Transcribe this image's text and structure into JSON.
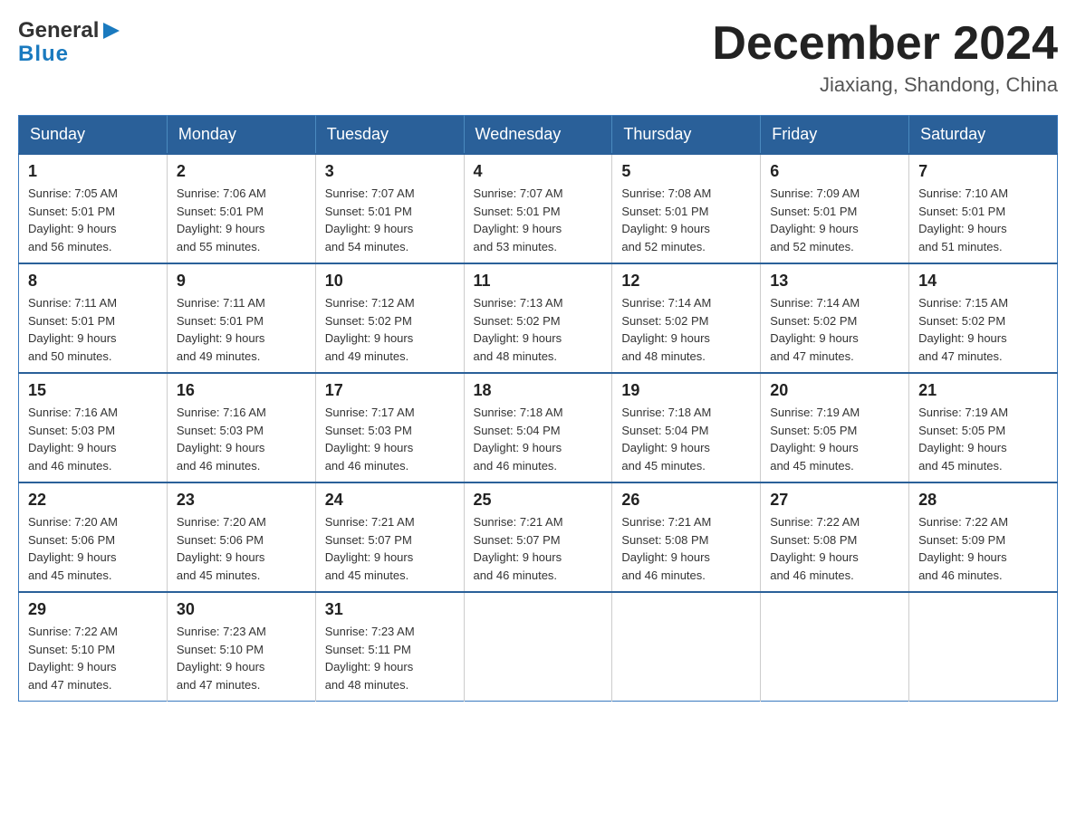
{
  "header": {
    "logo": {
      "general": "General",
      "blue": "Blue"
    },
    "title": "December 2024",
    "location": "Jiaxiang, Shandong, China"
  },
  "days_of_week": [
    "Sunday",
    "Monday",
    "Tuesday",
    "Wednesday",
    "Thursday",
    "Friday",
    "Saturday"
  ],
  "weeks": [
    {
      "days": [
        {
          "number": "1",
          "sunrise": "Sunrise: 7:05 AM",
          "sunset": "Sunset: 5:01 PM",
          "daylight": "Daylight: 9 hours",
          "daylight2": "and 56 minutes."
        },
        {
          "number": "2",
          "sunrise": "Sunrise: 7:06 AM",
          "sunset": "Sunset: 5:01 PM",
          "daylight": "Daylight: 9 hours",
          "daylight2": "and 55 minutes."
        },
        {
          "number": "3",
          "sunrise": "Sunrise: 7:07 AM",
          "sunset": "Sunset: 5:01 PM",
          "daylight": "Daylight: 9 hours",
          "daylight2": "and 54 minutes."
        },
        {
          "number": "4",
          "sunrise": "Sunrise: 7:07 AM",
          "sunset": "Sunset: 5:01 PM",
          "daylight": "Daylight: 9 hours",
          "daylight2": "and 53 minutes."
        },
        {
          "number": "5",
          "sunrise": "Sunrise: 7:08 AM",
          "sunset": "Sunset: 5:01 PM",
          "daylight": "Daylight: 9 hours",
          "daylight2": "and 52 minutes."
        },
        {
          "number": "6",
          "sunrise": "Sunrise: 7:09 AM",
          "sunset": "Sunset: 5:01 PM",
          "daylight": "Daylight: 9 hours",
          "daylight2": "and 52 minutes."
        },
        {
          "number": "7",
          "sunrise": "Sunrise: 7:10 AM",
          "sunset": "Sunset: 5:01 PM",
          "daylight": "Daylight: 9 hours",
          "daylight2": "and 51 minutes."
        }
      ]
    },
    {
      "days": [
        {
          "number": "8",
          "sunrise": "Sunrise: 7:11 AM",
          "sunset": "Sunset: 5:01 PM",
          "daylight": "Daylight: 9 hours",
          "daylight2": "and 50 minutes."
        },
        {
          "number": "9",
          "sunrise": "Sunrise: 7:11 AM",
          "sunset": "Sunset: 5:01 PM",
          "daylight": "Daylight: 9 hours",
          "daylight2": "and 49 minutes."
        },
        {
          "number": "10",
          "sunrise": "Sunrise: 7:12 AM",
          "sunset": "Sunset: 5:02 PM",
          "daylight": "Daylight: 9 hours",
          "daylight2": "and 49 minutes."
        },
        {
          "number": "11",
          "sunrise": "Sunrise: 7:13 AM",
          "sunset": "Sunset: 5:02 PM",
          "daylight": "Daylight: 9 hours",
          "daylight2": "and 48 minutes."
        },
        {
          "number": "12",
          "sunrise": "Sunrise: 7:14 AM",
          "sunset": "Sunset: 5:02 PM",
          "daylight": "Daylight: 9 hours",
          "daylight2": "and 48 minutes."
        },
        {
          "number": "13",
          "sunrise": "Sunrise: 7:14 AM",
          "sunset": "Sunset: 5:02 PM",
          "daylight": "Daylight: 9 hours",
          "daylight2": "and 47 minutes."
        },
        {
          "number": "14",
          "sunrise": "Sunrise: 7:15 AM",
          "sunset": "Sunset: 5:02 PM",
          "daylight": "Daylight: 9 hours",
          "daylight2": "and 47 minutes."
        }
      ]
    },
    {
      "days": [
        {
          "number": "15",
          "sunrise": "Sunrise: 7:16 AM",
          "sunset": "Sunset: 5:03 PM",
          "daylight": "Daylight: 9 hours",
          "daylight2": "and 46 minutes."
        },
        {
          "number": "16",
          "sunrise": "Sunrise: 7:16 AM",
          "sunset": "Sunset: 5:03 PM",
          "daylight": "Daylight: 9 hours",
          "daylight2": "and 46 minutes."
        },
        {
          "number": "17",
          "sunrise": "Sunrise: 7:17 AM",
          "sunset": "Sunset: 5:03 PM",
          "daylight": "Daylight: 9 hours",
          "daylight2": "and 46 minutes."
        },
        {
          "number": "18",
          "sunrise": "Sunrise: 7:18 AM",
          "sunset": "Sunset: 5:04 PM",
          "daylight": "Daylight: 9 hours",
          "daylight2": "and 46 minutes."
        },
        {
          "number": "19",
          "sunrise": "Sunrise: 7:18 AM",
          "sunset": "Sunset: 5:04 PM",
          "daylight": "Daylight: 9 hours",
          "daylight2": "and 45 minutes."
        },
        {
          "number": "20",
          "sunrise": "Sunrise: 7:19 AM",
          "sunset": "Sunset: 5:05 PM",
          "daylight": "Daylight: 9 hours",
          "daylight2": "and 45 minutes."
        },
        {
          "number": "21",
          "sunrise": "Sunrise: 7:19 AM",
          "sunset": "Sunset: 5:05 PM",
          "daylight": "Daylight: 9 hours",
          "daylight2": "and 45 minutes."
        }
      ]
    },
    {
      "days": [
        {
          "number": "22",
          "sunrise": "Sunrise: 7:20 AM",
          "sunset": "Sunset: 5:06 PM",
          "daylight": "Daylight: 9 hours",
          "daylight2": "and 45 minutes."
        },
        {
          "number": "23",
          "sunrise": "Sunrise: 7:20 AM",
          "sunset": "Sunset: 5:06 PM",
          "daylight": "Daylight: 9 hours",
          "daylight2": "and 45 minutes."
        },
        {
          "number": "24",
          "sunrise": "Sunrise: 7:21 AM",
          "sunset": "Sunset: 5:07 PM",
          "daylight": "Daylight: 9 hours",
          "daylight2": "and 45 minutes."
        },
        {
          "number": "25",
          "sunrise": "Sunrise: 7:21 AM",
          "sunset": "Sunset: 5:07 PM",
          "daylight": "Daylight: 9 hours",
          "daylight2": "and 46 minutes."
        },
        {
          "number": "26",
          "sunrise": "Sunrise: 7:21 AM",
          "sunset": "Sunset: 5:08 PM",
          "daylight": "Daylight: 9 hours",
          "daylight2": "and 46 minutes."
        },
        {
          "number": "27",
          "sunrise": "Sunrise: 7:22 AM",
          "sunset": "Sunset: 5:08 PM",
          "daylight": "Daylight: 9 hours",
          "daylight2": "and 46 minutes."
        },
        {
          "number": "28",
          "sunrise": "Sunrise: 7:22 AM",
          "sunset": "Sunset: 5:09 PM",
          "daylight": "Daylight: 9 hours",
          "daylight2": "and 46 minutes."
        }
      ]
    },
    {
      "days": [
        {
          "number": "29",
          "sunrise": "Sunrise: 7:22 AM",
          "sunset": "Sunset: 5:10 PM",
          "daylight": "Daylight: 9 hours",
          "daylight2": "and 47 minutes."
        },
        {
          "number": "30",
          "sunrise": "Sunrise: 7:23 AM",
          "sunset": "Sunset: 5:10 PM",
          "daylight": "Daylight: 9 hours",
          "daylight2": "and 47 minutes."
        },
        {
          "number": "31",
          "sunrise": "Sunrise: 7:23 AM",
          "sunset": "Sunset: 5:11 PM",
          "daylight": "Daylight: 9 hours",
          "daylight2": "and 48 minutes."
        },
        null,
        null,
        null,
        null
      ]
    }
  ]
}
